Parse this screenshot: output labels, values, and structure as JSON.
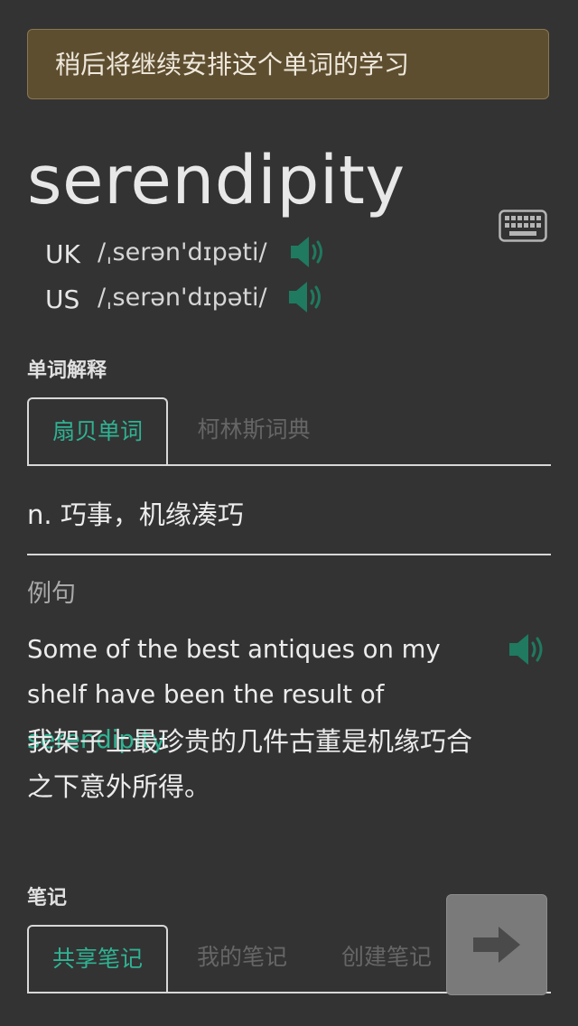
{
  "banner": {
    "text": "稍后将继续安排这个单词的学习"
  },
  "word": {
    "text": "serendipity"
  },
  "keyboard": {
    "icon": "keyboard-icon"
  },
  "pronunciations": [
    {
      "region": "UK",
      "ipa": "/ˌserən'dɪpəti/",
      "icon": "speaker-icon"
    },
    {
      "region": "US",
      "ipa": "/ˌserən'dɪpəti/",
      "icon": "speaker-icon"
    }
  ],
  "definition_section": {
    "label": "单词解释",
    "tabs": [
      {
        "label": "扇贝单词",
        "active": true
      },
      {
        "label": "柯林斯词典",
        "active": false
      }
    ],
    "definition": "n. 巧事，机缘凑巧"
  },
  "example": {
    "label": "例句",
    "en_before": "Some of the best antiques on my shelf have been the result of ",
    "en_highlight": "serendipity",
    "en_after": ".",
    "zh": "我架子上最珍贵的几件古董是机缘巧合之下意外所得。",
    "icon": "speaker-icon"
  },
  "notes_section": {
    "label": "笔记",
    "tabs": [
      {
        "label": "共享笔记",
        "active": true
      },
      {
        "label": "我的笔记",
        "active": false
      },
      {
        "label": "创建笔记",
        "active": false
      }
    ]
  },
  "next_button": {
    "icon": "arrow-right-icon"
  },
  "colors": {
    "background": "#333333",
    "accent": "#2fb393",
    "banner": "#5e4e30",
    "speaker": "#1f7a5f",
    "next_button": "#7a7a7a"
  }
}
